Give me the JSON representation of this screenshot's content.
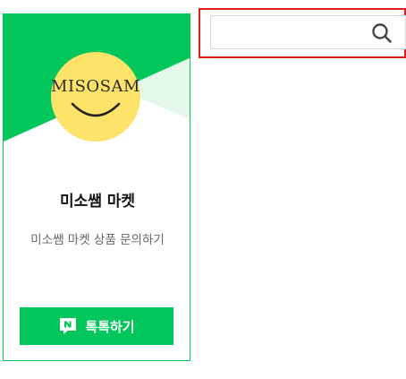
{
  "card": {
    "logo_text": "MISOSAM",
    "title": "미소쌤 마켓",
    "description": "미소쌤 마켓 상품 문의하기",
    "talk_button_label": "톡톡하기",
    "talk_icon": "naver-n-chat-icon"
  },
  "search": {
    "value": "",
    "placeholder": "",
    "icon": "search-icon"
  },
  "colors": {
    "brand_green": "#03c75a",
    "light_green": "#e4f8e9",
    "logo_yellow": "#fde36a",
    "highlight_red": "#e01c1c"
  }
}
